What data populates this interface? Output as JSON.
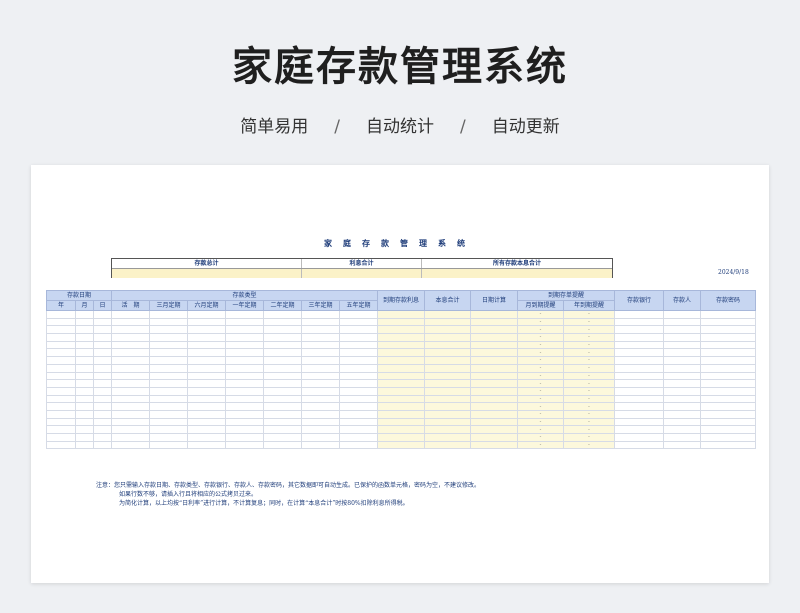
{
  "hero": {
    "title": "家庭存款管理系统",
    "tags": [
      "简单易用",
      "自动统计",
      "自动更新"
    ],
    "separator": "/"
  },
  "sheet": {
    "title": "家庭存款管理系统",
    "summary_labels": [
      "存款总计",
      "利息合计",
      "所有存款本息合计"
    ],
    "date": "2024/9/18",
    "header_groups": {
      "deposit_date": "存款日期",
      "deposit_type": "存款类型",
      "maturity_interest": "到期存款利息",
      "total_interest": "本息合计",
      "date_calc": "日期计算",
      "reminder": "到期存单提醒",
      "bank": "存款银行",
      "depositor": "存款人",
      "password": "存款密码"
    },
    "date_cols": [
      "年",
      "月",
      "日"
    ],
    "type_cols": [
      "活　期",
      "三月定期",
      "六月定期",
      "一年定期",
      "二年定期",
      "三年定期",
      "五年定期"
    ],
    "reminder_cols": [
      "月到期提醒",
      "年到期提醒"
    ],
    "row_placeholder": "-",
    "row_count": 18,
    "notes": [
      "注意：您只需输入存款日期、存款类型、存款银行、存款人、存款密码，其它数据即可自动生成。已保护的函数单元格，密码为空，不建议修改。",
      "如果行数不够，请插入行且将相应的公式拷贝过来。",
      "为简化计算，以上均按“日利率”进行计算，不计算复息；同时，在计算“本息合计”时按80%扣除利息所得税。"
    ]
  },
  "colors": {
    "header_fill": "#c7d6f1",
    "formula_fill": "#fcf8dc",
    "text_navy": "#1f3d7a"
  }
}
